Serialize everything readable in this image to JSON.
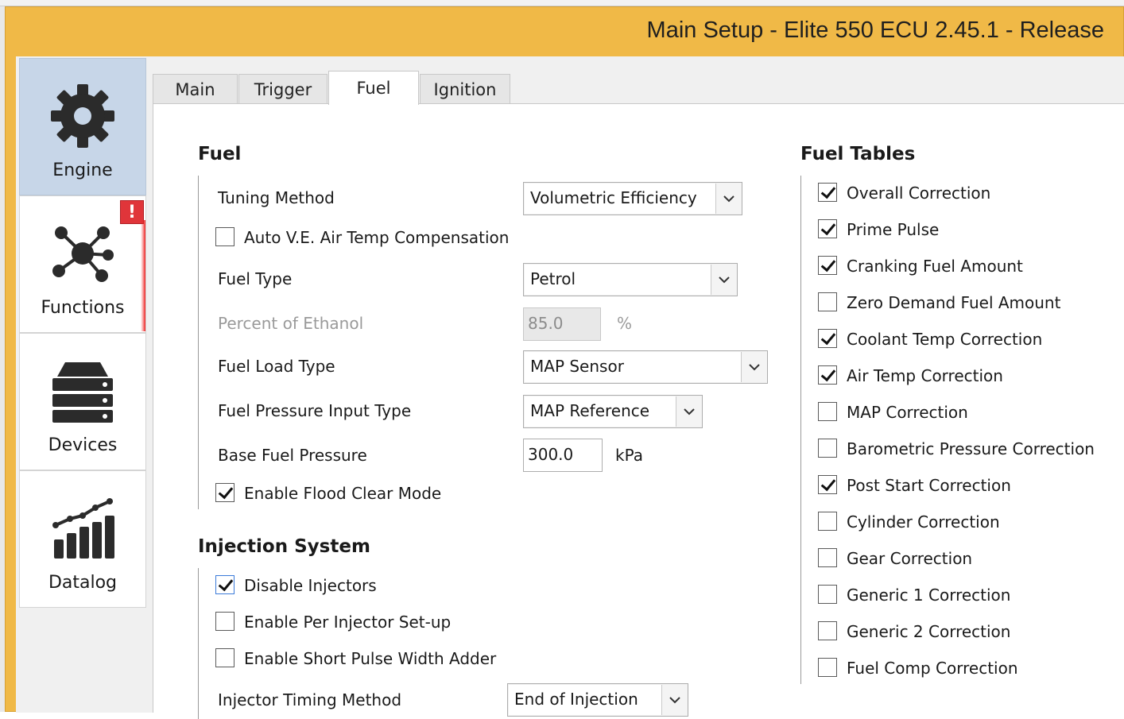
{
  "window": {
    "title": "Main Setup - Elite 550 ECU 2.45.1 - Release"
  },
  "sidebar": {
    "items": [
      {
        "label": "Engine",
        "icon": "gear-icon",
        "active": true
      },
      {
        "label": "Functions",
        "icon": "network-icon",
        "badge": "!"
      },
      {
        "label": "Devices",
        "icon": "server-stack-icon"
      },
      {
        "label": "Datalog",
        "icon": "bar-chart-icon"
      }
    ]
  },
  "tabs": [
    {
      "label": "Main"
    },
    {
      "label": "Trigger"
    },
    {
      "label": "Fuel",
      "active": true
    },
    {
      "label": "Ignition"
    }
  ],
  "fuel": {
    "title": "Fuel",
    "tuning_method": {
      "label": "Tuning Method",
      "value": "Volumetric Efficiency"
    },
    "auto_ve": {
      "label": "Auto V.E. Air Temp Compensation",
      "checked": false
    },
    "fuel_type": {
      "label": "Fuel Type",
      "value": "Petrol"
    },
    "ethanol": {
      "label": "Percent of Ethanol",
      "value": "85.0",
      "unit": "%",
      "disabled": true
    },
    "fuel_load_type": {
      "label": "Fuel Load Type",
      "value": "MAP Sensor"
    },
    "pressure_input": {
      "label": "Fuel Pressure Input Type",
      "value": "MAP Reference"
    },
    "base_pressure": {
      "label": "Base Fuel Pressure",
      "value": "300.0",
      "unit": "kPa"
    },
    "flood_clear": {
      "label": "Enable Flood Clear Mode",
      "checked": true
    }
  },
  "injection": {
    "title": "Injection System",
    "disable_injectors": {
      "label": "Disable Injectors",
      "checked": true
    },
    "per_injector": {
      "label": "Enable Per Injector Set-up",
      "checked": false
    },
    "short_pulse": {
      "label": "Enable Short Pulse Width Adder",
      "checked": false
    },
    "timing_method": {
      "label": "Injector Timing Method",
      "value": "End of Injection"
    }
  },
  "fuel_tables": {
    "title": "Fuel Tables",
    "items": [
      {
        "label": "Overall Correction",
        "checked": true
      },
      {
        "label": "Prime Pulse",
        "checked": true
      },
      {
        "label": "Cranking Fuel Amount",
        "checked": true
      },
      {
        "label": "Zero Demand Fuel Amount",
        "checked": false
      },
      {
        "label": "Coolant Temp Correction",
        "checked": true
      },
      {
        "label": "Air Temp Correction",
        "checked": true
      },
      {
        "label": "MAP Correction",
        "checked": false
      },
      {
        "label": "Barometric Pressure Correction",
        "checked": false
      },
      {
        "label": "Post Start Correction",
        "checked": true
      },
      {
        "label": "Cylinder Correction",
        "checked": false
      },
      {
        "label": "Gear Correction",
        "checked": false
      },
      {
        "label": "Generic 1 Correction",
        "checked": false
      },
      {
        "label": "Generic 2 Correction",
        "checked": false
      },
      {
        "label": "Fuel Comp Correction",
        "checked": false
      }
    ]
  },
  "colors": {
    "titlebar": "#f0b947",
    "sidebar_active": "#c7d6e8",
    "alert": "#e0353a"
  }
}
